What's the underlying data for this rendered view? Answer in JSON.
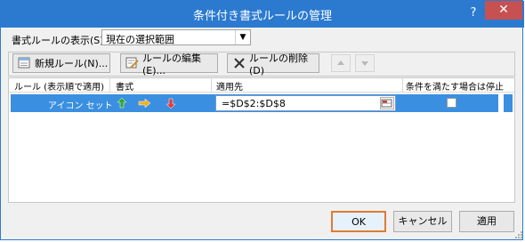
{
  "window": {
    "title": "条件付き書式ルールの管理",
    "help_label": "?",
    "close_label": "✕"
  },
  "show_rules": {
    "label": "書式ルールの表示(S):",
    "selected": "現在の選択範囲"
  },
  "toolbar": {
    "new_rule": "新規ルール(N)...",
    "edit_rule": "ルールの編集(E)...",
    "delete_rule": "ルールの削除(D)",
    "icons": {
      "new": "new-rule-icon",
      "edit": "edit-rule-icon",
      "delete": "delete-x-icon",
      "up": "move-up-arrow-icon",
      "down": "move-down-arrow-icon"
    }
  },
  "grid": {
    "headers": {
      "rule": "ルール (表示順で適用)",
      "format": "書式",
      "applies_to": "適用先",
      "stop_if_true": "条件を満たす場合は停止"
    },
    "rows": [
      {
        "rule": "アイコン セット",
        "format_icons": [
          "green-up-arrow-icon",
          "yellow-right-arrow-icon",
          "red-down-arrow-icon"
        ],
        "applies_to": "=$D$2:$D$8",
        "stop_if_true": false
      }
    ]
  },
  "buttons": {
    "ok": "OK",
    "cancel": "キャンセル",
    "apply": "適用"
  },
  "colors": {
    "titlebar": "#2b7ad0",
    "selection": "#3a8fe0",
    "close": "#c75050",
    "ok_highlight": "#e07b35"
  }
}
